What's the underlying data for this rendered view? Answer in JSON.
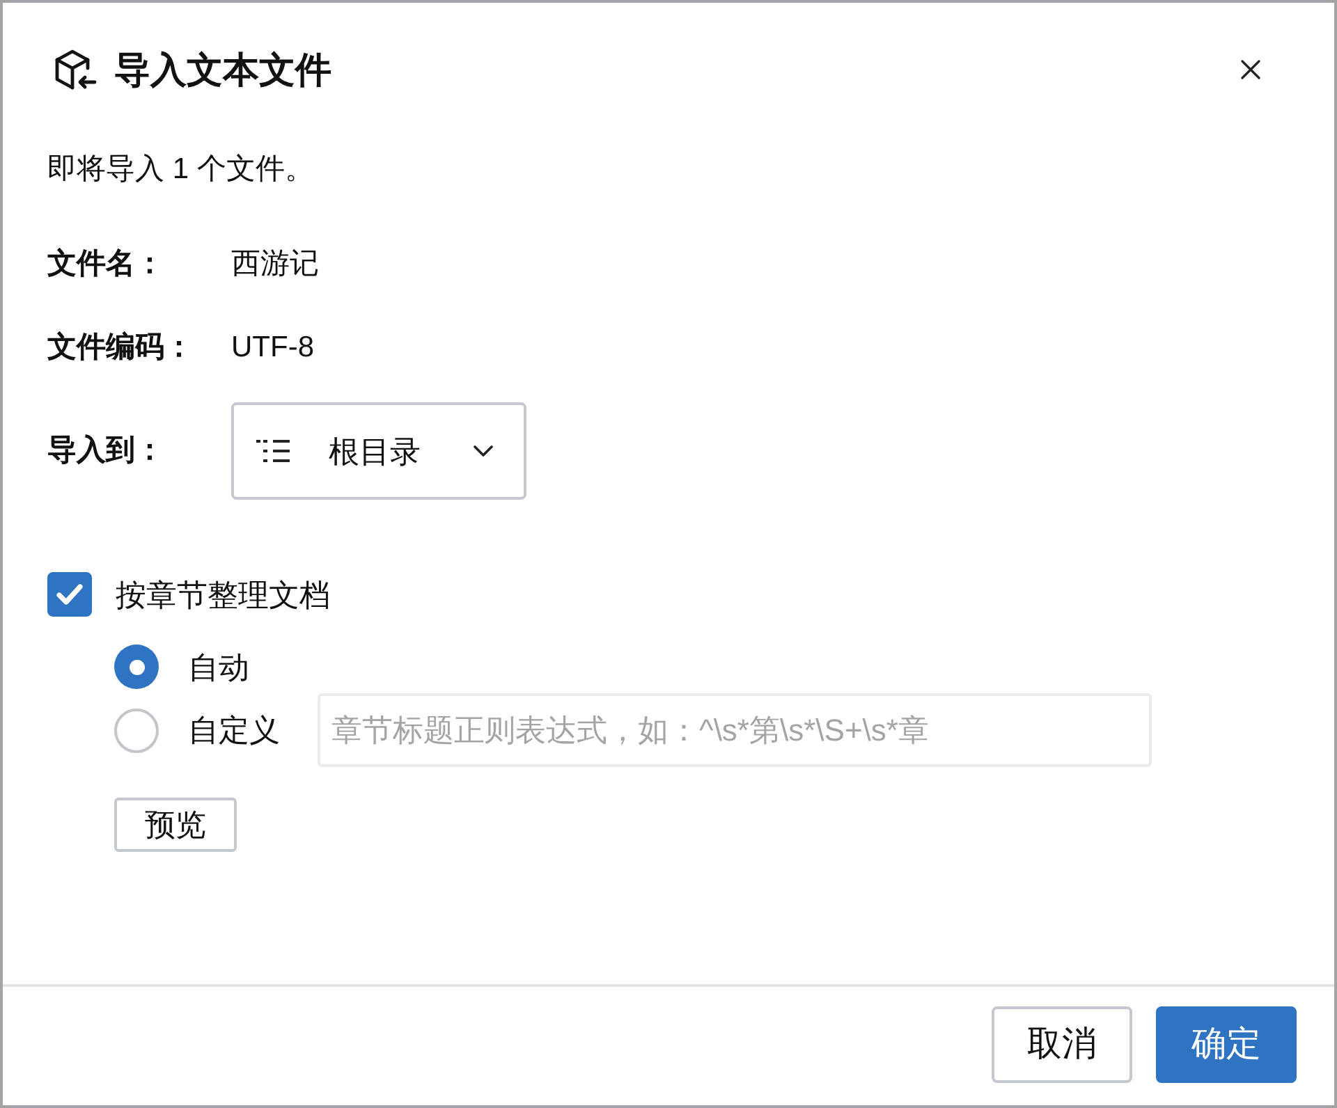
{
  "dialog": {
    "title": "导入文本文件",
    "message": "即将导入 1 个文件。"
  },
  "fields": [
    {
      "kind": "text",
      "label": "文件名：",
      "value": "西游记"
    },
    {
      "kind": "text",
      "label": "文件编码：",
      "value": "UTF-8"
    },
    {
      "kind": "select",
      "label": "导入到：",
      "value": "根目录"
    }
  ],
  "organize": {
    "label": "按章节整理文档",
    "checked": true,
    "options": [
      {
        "label": "自动",
        "selected": true
      },
      {
        "label": "自定义",
        "selected": false
      }
    ],
    "pattern": {
      "placeholder": "章节标题正则表达式，如：^\\s*第\\s*\\S+\\s*章"
    },
    "preview_button": "预览"
  },
  "buttons": [
    {
      "label": "取消",
      "kind": "secondary"
    },
    {
      "label": "确定",
      "kind": "primary"
    }
  ]
}
